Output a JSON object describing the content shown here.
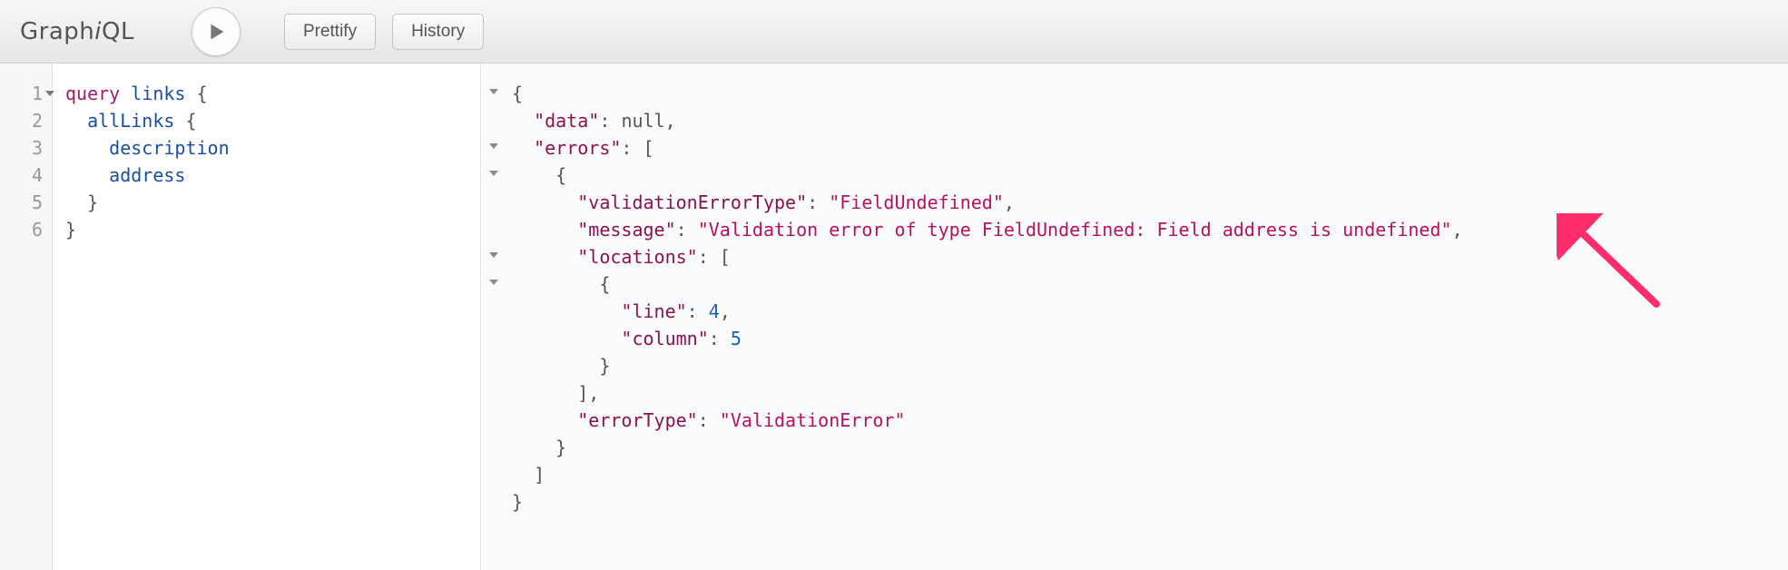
{
  "logo": {
    "prefix": "Graph",
    "italic": "i",
    "suffix": "QL"
  },
  "toolbar": {
    "prettify_label": "Prettify",
    "history_label": "History"
  },
  "editor": {
    "lines": [
      {
        "n": "1",
        "foldable": true
      },
      {
        "n": "2",
        "foldable": false
      },
      {
        "n": "3",
        "foldable": false
      },
      {
        "n": "4",
        "foldable": false
      },
      {
        "n": "5",
        "foldable": false
      },
      {
        "n": "6",
        "foldable": false
      }
    ],
    "code": {
      "kw_query": "query",
      "name": "links",
      "brace_open": "{",
      "field_allLinks": "allLinks",
      "brace_open2": "{",
      "field_description": "description",
      "field_address": "address",
      "brace_close": "}",
      "brace_close2": "}"
    }
  },
  "result": {
    "fold_rows": [
      0,
      2,
      3,
      4,
      7
    ],
    "json": {
      "brace_open": "{",
      "data_key": "\"data\"",
      "data_val": "null",
      "errors_key": "\"errors\"",
      "bracket_open": "[",
      "obj_open": "{",
      "validationErrorType_key": "\"validationErrorType\"",
      "validationErrorType_val": "\"FieldUndefined\"",
      "message_key": "\"message\"",
      "message_val": "\"Validation error of type FieldUndefined: Field address is undefined\"",
      "locations_key": "\"locations\"",
      "loc_bracket_open": "[",
      "loc_obj_open": "{",
      "line_key": "\"line\"",
      "line_val": "4",
      "column_key": "\"column\"",
      "column_val": "5",
      "loc_obj_close": "}",
      "loc_bracket_close": "]",
      "errorType_key": "\"errorType\"",
      "errorType_val": "\"ValidationError\"",
      "obj_close": "}",
      "bracket_close": "]",
      "brace_close": "}"
    }
  }
}
